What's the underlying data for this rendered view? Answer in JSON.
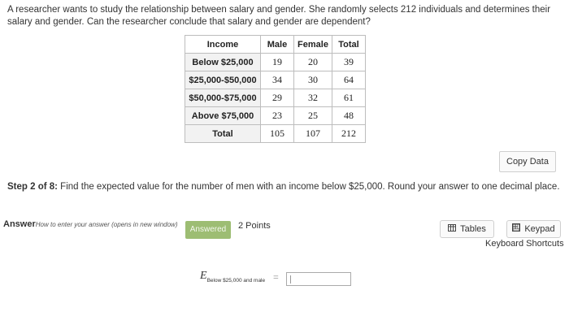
{
  "question": {
    "text": "A researcher wants to study the relationship between salary and gender. She randomly selects 212 individuals and determines their salary and gender. Can the researcher conclude that salary and gender are dependent?"
  },
  "table": {
    "headers": [
      "Income",
      "Male",
      "Female",
      "Total"
    ],
    "rows": [
      {
        "label": "Below $25,000",
        "male": "19",
        "female": "20",
        "total": "39"
      },
      {
        "label": "$25,000-$50,000",
        "male": "34",
        "female": "30",
        "total": "64"
      },
      {
        "label": "$50,000-$75,000",
        "male": "29",
        "female": "32",
        "total": "61"
      },
      {
        "label": "Above $75,000",
        "male": "23",
        "female": "25",
        "total": "48"
      },
      {
        "label": "Total",
        "male": "105",
        "female": "107",
        "total": "212"
      }
    ]
  },
  "copy_data_label": "Copy Data",
  "step": {
    "prefix": "Step 2 of 8:",
    "text": " Find the expected value for the number of men with an income below $25,000. Round your answer to one decimal place."
  },
  "answer": {
    "label": "Answer",
    "howto": "How to enter your answer (opens in new window)",
    "status": "Answered",
    "points": "2 Points"
  },
  "tools": {
    "tables_label": "Tables",
    "keypad_label": "Keypad",
    "keyboard_shortcuts": "Keyboard Shortcuts"
  },
  "formula": {
    "symbol": "E",
    "subscript": "Below $25,000 and male",
    "equals": "=",
    "value": ""
  }
}
